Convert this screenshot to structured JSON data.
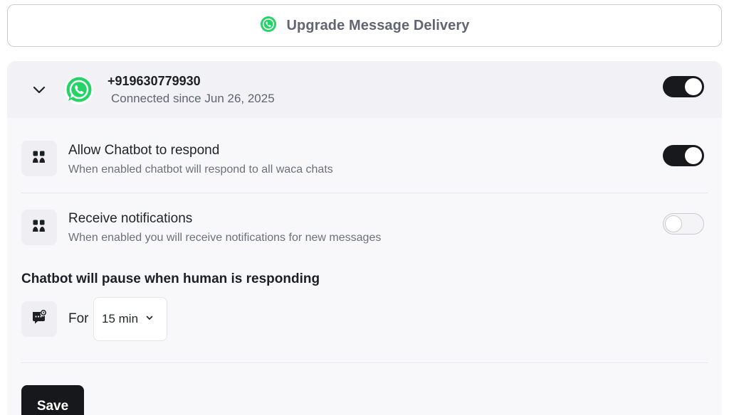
{
  "upgrade": {
    "label": "Upgrade Message Delivery",
    "icon": "whatsapp-icon"
  },
  "account": {
    "phone": "+919630779930",
    "connected": "Connected since Jun 26, 2025",
    "enabled": true,
    "icon": "whatsapp-logo-icon"
  },
  "settings": [
    {
      "title": "Allow Chatbot to respond",
      "subtitle": "When enabled chatbot will respond to all waca chats",
      "enabled": true,
      "icon": "users-icon"
    },
    {
      "title": "Receive notifications",
      "subtitle": "When enabled you will receive notifications for new messages",
      "enabled": false,
      "icon": "users-icon"
    }
  ],
  "pause": {
    "heading": "Chatbot will pause when human is responding",
    "for_label": "For",
    "duration": "15 min",
    "icon": "chat-clock-icon"
  },
  "save_label": "Save",
  "colors": {
    "accent": "#18191c",
    "whatsapp": "#25d366"
  }
}
